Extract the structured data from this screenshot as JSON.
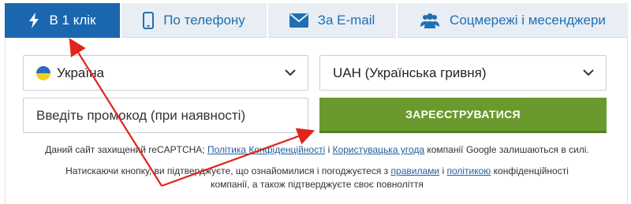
{
  "tabs": [
    {
      "label": "В 1 клік",
      "icon": "lightning-icon",
      "active": true
    },
    {
      "label": "По телефону",
      "icon": "smartphone-icon",
      "active": false
    },
    {
      "label": "За E-mail",
      "icon": "envelope-icon",
      "active": false
    },
    {
      "label": "Соцмережі і месенджери",
      "icon": "users-icon",
      "active": false
    }
  ],
  "form": {
    "country": {
      "value": "Україна",
      "flag": "ukraine-flag"
    },
    "currency": {
      "value": "UAH (Українська гривня)"
    },
    "promo": {
      "placeholder": "Введіть промокод (при наявності)"
    },
    "register_label": "ЗАРЕЄСТРУВАТИСЯ"
  },
  "notes": {
    "recaptcha": {
      "prefix": "Даний сайт захищений reCAPTCHA;",
      "privacy_link": "Політика Конфіденційності",
      "separator": "і",
      "terms_link": "Користувацька угода",
      "suffix": "компанії Google залишаються в силі."
    },
    "consent": {
      "prefix": "Натискаючи кнопку, ви підтверджуєте, що ознайомилися і погоджуєтеся з",
      "rules_link": "правилами",
      "and": "і",
      "policy_link": "політикою",
      "suffix": "конфіденційності",
      "line2": "компанії, а також підтверджуєте своє повноліття"
    }
  },
  "colors": {
    "tab_active": "#1a67b0",
    "tab_bg": "#e8eef4",
    "tab_text": "#1f6fb5",
    "register_bg": "#6a9a2e",
    "link": "#1f5f9e",
    "arrow": "#e0251b"
  }
}
